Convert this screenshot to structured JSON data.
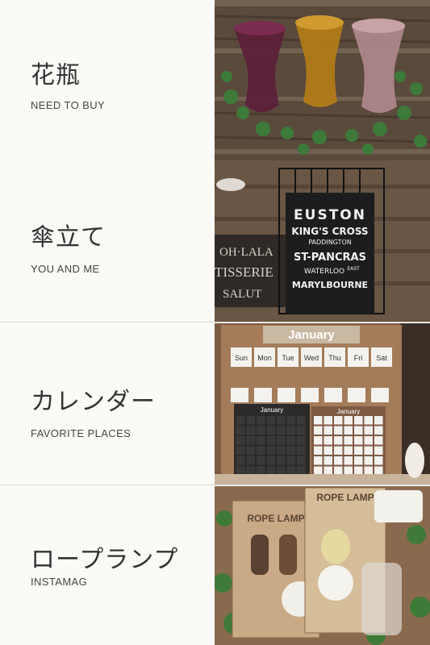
{
  "items": [
    {
      "title": "花瓶",
      "subtitle": "NEED TO BUY",
      "image": "colored-glass-vases-photo"
    },
    {
      "title": "傘立て",
      "subtitle": "YOU AND ME",
      "image": "euston-sign-umbrella-stand-photo"
    },
    {
      "title": "カレンダー",
      "subtitle": "FAVORITE PLACES",
      "image": "january-tile-calendar-photo"
    },
    {
      "title": "ロープランプ",
      "subtitle": "INSTAMAG",
      "image": "rope-lamp-packages-photo"
    }
  ],
  "photo_text": {
    "sign": [
      "EUSTON",
      "KING'S CROSS",
      "PADDINGTON",
      "ST-PANCRAS",
      "WATERLOO",
      "EAST",
      "MARYLBOURNE"
    ],
    "bg_sign": [
      "OH·LALA",
      "TISSERIE",
      "SALUT"
    ],
    "calendar_month": "January",
    "weekdays": [
      "Sun",
      "Mon",
      "Tue",
      "Wed",
      "Thu",
      "Fri",
      "Sat"
    ],
    "lamp_label": "ROPE LAMP"
  }
}
